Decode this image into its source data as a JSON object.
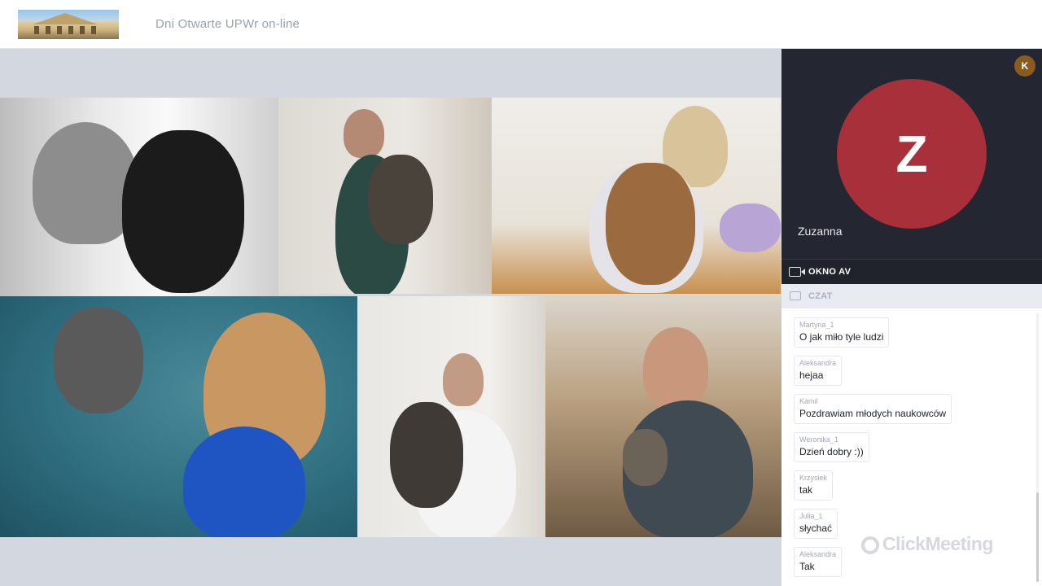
{
  "header": {
    "event_title": "Dni Otwarte UPWr on-line"
  },
  "av_window": {
    "badge": "K",
    "avatar_letter": "Z",
    "speaker_name": "Zuzanna",
    "label": "OKNO AV"
  },
  "chat": {
    "label": "CZAT",
    "messages": [
      {
        "author": "Martyna_1",
        "text": "O jak miło tyle ludzi"
      },
      {
        "author": "Aleksandra",
        "text": "hejaa"
      },
      {
        "author": "Kamil",
        "text": "Pozdrawiam młodych naukowców"
      },
      {
        "author": "Weronika_1",
        "text": "Dzień dobry :))"
      },
      {
        "author": "Krzysiek",
        "text": "tak"
      },
      {
        "author": "Julia_1",
        "text": "słychać"
      },
      {
        "author": "Aleksandra",
        "text": "Tak"
      }
    ]
  },
  "brand": {
    "name": "ClickMeeting"
  },
  "colors": {
    "avatar": "#a8303b",
    "badge": "#8a5a1e",
    "av_bg": "#242732"
  }
}
